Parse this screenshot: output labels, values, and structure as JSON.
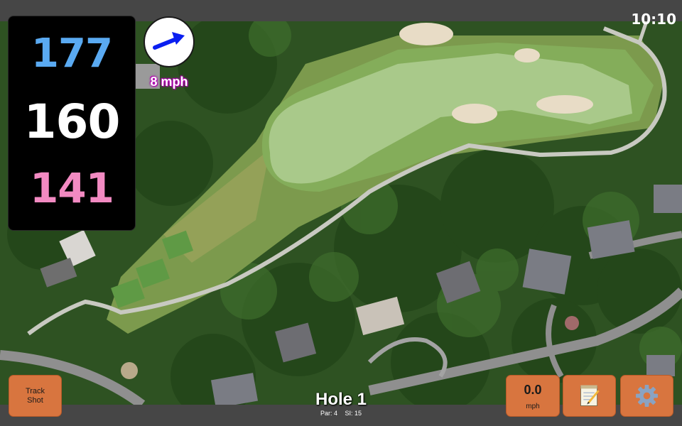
{
  "status": {
    "time": "10:10"
  },
  "distances": {
    "back": "177",
    "middle": "160",
    "front": "141"
  },
  "wind": {
    "speed": "8 mph",
    "icon": "wind-direction-arrow-icon",
    "arrow_color": "#0a1ff0"
  },
  "hole": {
    "title": "Hole 1",
    "par": "Par: 4",
    "si": "SI: 15"
  },
  "buttons": {
    "track_shot": "Track\nShot",
    "speed_value": "0.0",
    "speed_unit": "mph",
    "notes_icon": "notepad-icon",
    "settings_icon": "gear-icon"
  },
  "colors": {
    "accent_button": "#d8753f",
    "distance_back": "#5aaaf2",
    "distance_middle": "#ffffff",
    "distance_front": "#f28ac2",
    "wind_label_outline": "#b100b1"
  }
}
